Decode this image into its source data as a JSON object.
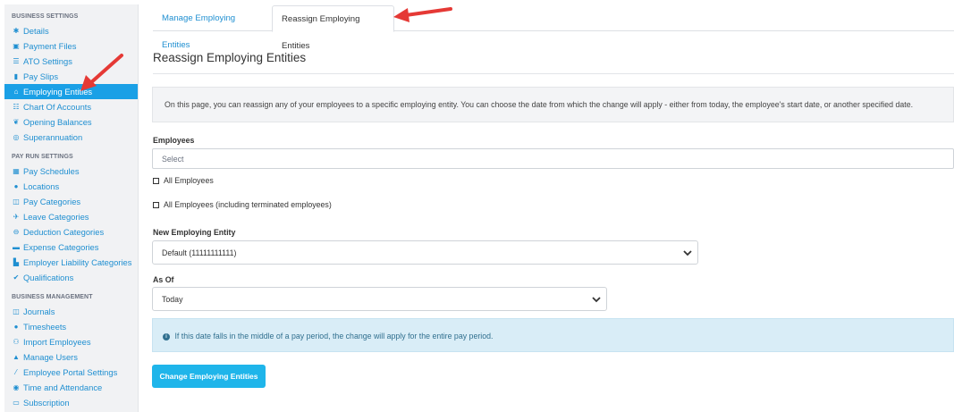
{
  "sidebar": {
    "sections": [
      {
        "title": "BUSINESS SETTINGS",
        "items": [
          {
            "label": "Details",
            "icon": "gear-icon"
          },
          {
            "label": "Payment Files",
            "icon": "save-icon"
          },
          {
            "label": "ATO Settings",
            "icon": "sliders-icon"
          },
          {
            "label": "Pay Slips",
            "icon": "file-icon"
          },
          {
            "label": "Employing Entities",
            "icon": "bank-icon",
            "active": true
          },
          {
            "label": "Chart Of Accounts",
            "icon": "list-icon"
          },
          {
            "label": "Opening Balances",
            "icon": "leaf-icon"
          },
          {
            "label": "Superannuation",
            "icon": "lifebuoy-icon"
          }
        ]
      },
      {
        "title": "PAY RUN SETTINGS",
        "items": [
          {
            "label": "Pay Schedules",
            "icon": "calendar-icon"
          },
          {
            "label": "Locations",
            "icon": "globe-icon"
          },
          {
            "label": "Pay Categories",
            "icon": "money-icon"
          },
          {
            "label": "Leave Categories",
            "icon": "plane-icon"
          },
          {
            "label": "Deduction Categories",
            "icon": "minus-circle-icon"
          },
          {
            "label": "Expense Categories",
            "icon": "archive-icon"
          },
          {
            "label": "Employer Liability Categories",
            "icon": "chart-icon"
          },
          {
            "label": "Qualifications",
            "icon": "check-icon"
          }
        ]
      },
      {
        "title": "BUSINESS MANAGEMENT",
        "items": [
          {
            "label": "Journals",
            "icon": "columns-icon"
          },
          {
            "label": "Timesheets",
            "icon": "clock-icon"
          },
          {
            "label": "Import Employees",
            "icon": "users-icon"
          },
          {
            "label": "Manage Users",
            "icon": "lock-icon"
          },
          {
            "label": "Employee Portal Settings",
            "icon": "magic-icon"
          },
          {
            "label": "Time and Attendance",
            "icon": "clock-user-icon"
          },
          {
            "label": "Subscription",
            "icon": "card-icon"
          }
        ]
      }
    ]
  },
  "tabs": {
    "manage": "Manage Employing Entities",
    "reassign": "Reassign Employing Entities"
  },
  "page": {
    "title": "Reassign Employing Entities",
    "info": "On this page, you can reassign any of your employees to a specific employing entity. You can choose the date from which the change will apply - either from today, the employee's start date, or another specified date."
  },
  "form": {
    "employees_label": "Employees",
    "employees_placeholder": "Select",
    "all_employees": "All Employees",
    "all_employees_terminated": "All Employees (including terminated employees)",
    "new_entity_label": "New Employing Entity",
    "new_entity_value": "Default (11111111111)",
    "as_of_label": "As Of",
    "as_of_value": "Today",
    "alert_text": "If this date falls in the middle of a pay period, the change will apply for the entire pay period.",
    "submit_label": "Change Employing Entities"
  },
  "colors": {
    "accent": "#1aa0e6",
    "button": "#1fb5ea",
    "link": "#1f8fd1",
    "annotation": "#e53935"
  }
}
